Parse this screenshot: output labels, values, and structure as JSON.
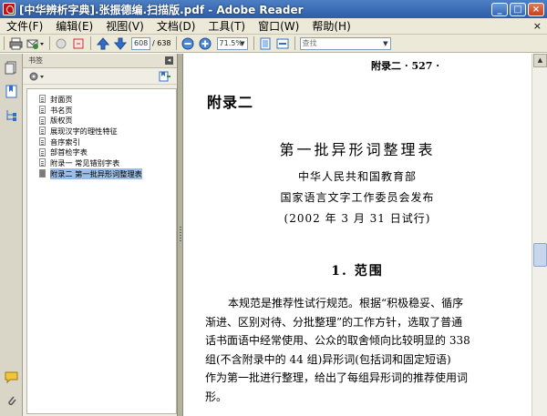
{
  "window": {
    "title": "[中华辨析字典].张振德编.扫描版.pdf - Adobe Reader"
  },
  "menu": {
    "items": [
      "文件(F)",
      "编辑(E)",
      "视图(V)",
      "文档(D)",
      "工具(T)",
      "窗口(W)",
      "帮助(H)"
    ],
    "close_glyph": "×"
  },
  "toolbar": {
    "page_number": "608",
    "page_count": "/ 638",
    "zoom": "71.5%",
    "search_placeholder": "查找"
  },
  "bookmarks_panel": {
    "header": "书签",
    "items": [
      {
        "label": "封面页",
        "selected": false
      },
      {
        "label": "书名页",
        "selected": false
      },
      {
        "label": "版权页",
        "selected": false
      },
      {
        "label": "展现汉字的理性特征",
        "selected": false
      },
      {
        "label": "音序索引",
        "selected": false
      },
      {
        "label": "部首检字表",
        "selected": false
      },
      {
        "label": "附录一 常见错别字表",
        "selected": false
      },
      {
        "label": "附录二 第一批异形词整理表",
        "selected": true
      }
    ]
  },
  "document": {
    "running_head": "附录二   · 527 ·",
    "appendix_title": "附录二",
    "main_title": "第一批异形词整理表",
    "issuer_line1": "中华人民共和国教育部",
    "issuer_line2": "国家语言文字工作委员会发布",
    "issuer_line3": "(2002 年 3 月 31 日试行)",
    "section_title": "1. 范围",
    "paragraph_lines": [
      "本规范是推荐性试行规范。根据“积极稳妥、循序",
      "渐进、区别对待、分批整理”的工作方针，选取了普通",
      "话书面语中经常使用、公众的取舍倾向比较明显的 338",
      "组(不含附录中的 44 组)异形词(包括词和固定短语)",
      "作为第一批进行整理，给出了每组异形词的推荐使用词",
      "形。"
    ]
  }
}
